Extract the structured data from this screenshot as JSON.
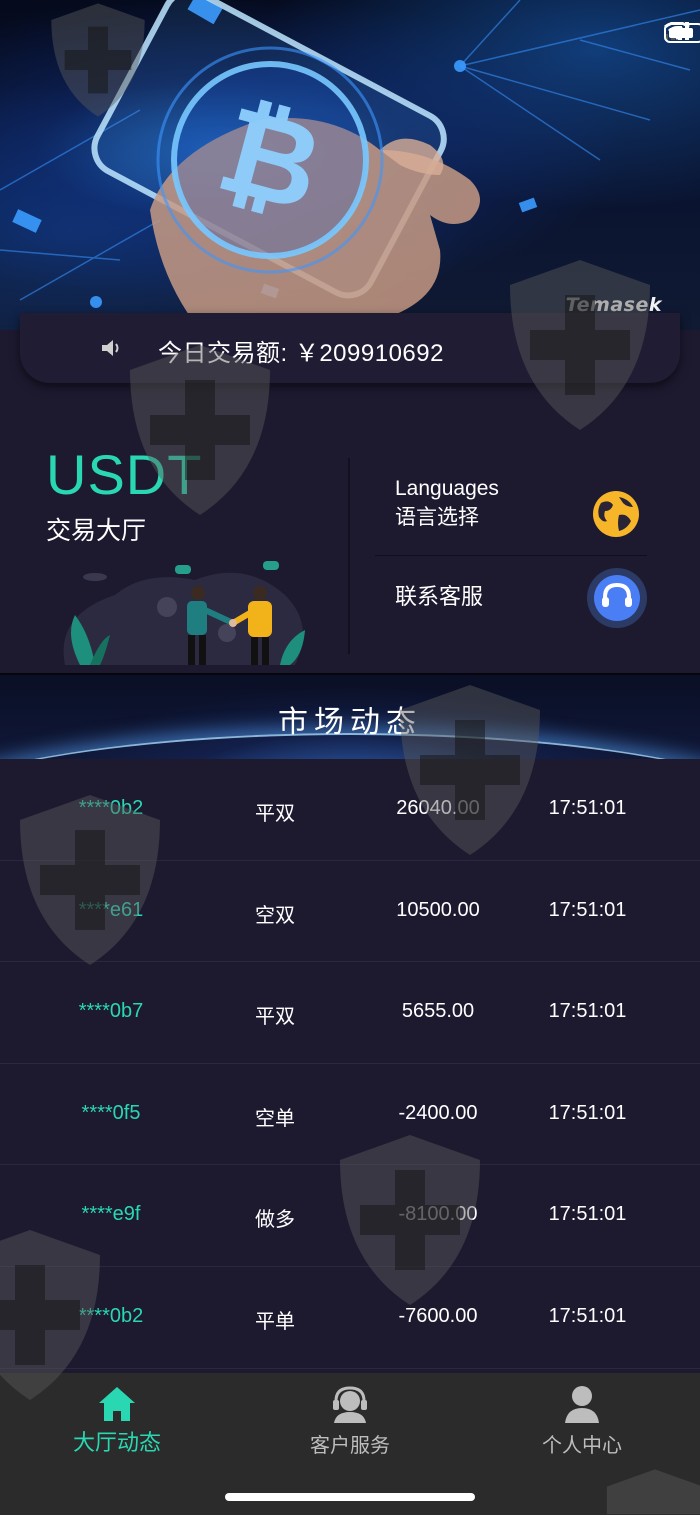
{
  "hero": {
    "brand": "Temasek",
    "image_alt": "hand holding bitcoin card"
  },
  "ticker": {
    "icon": "speaker-icon",
    "text": "今日交易额: ￥209910692"
  },
  "hall": {
    "title": "USDT",
    "subtitle": "交易大厅"
  },
  "menu": {
    "languages_en": "Languages",
    "languages_zh": "语言选择",
    "languages_icon": "globe-icon",
    "contact": "联系客服",
    "contact_icon": "headset-icon"
  },
  "market": {
    "title": "市场动态",
    "rows": [
      {
        "user": "****0b2",
        "type": "平双",
        "amount": "26040.00",
        "time": "17:51:01"
      },
      {
        "user": "****e61",
        "type": "空双",
        "amount": "10500.00",
        "time": "17:51:01"
      },
      {
        "user": "****0b7",
        "type": "平双",
        "amount": "5655.00",
        "time": "17:51:01"
      },
      {
        "user": "****0f5",
        "type": "空单",
        "amount": "-2400.00",
        "time": "17:51:01"
      },
      {
        "user": "****e9f",
        "type": "做多",
        "amount": "-8100.00",
        "time": "17:51:01"
      },
      {
        "user": "****0b2",
        "type": "平单",
        "amount": "-7600.00",
        "time": "17:51:01"
      }
    ]
  },
  "nav": {
    "home": {
      "label": "大厅动态",
      "icon": "home-icon"
    },
    "service": {
      "label": "客户服务",
      "icon": "headset-icon"
    },
    "me": {
      "label": "个人中心",
      "icon": "user-icon"
    }
  },
  "colors": {
    "accent": "#2ad7b3",
    "background": "#1d1a30",
    "nav_background": "#2b2b2b"
  }
}
